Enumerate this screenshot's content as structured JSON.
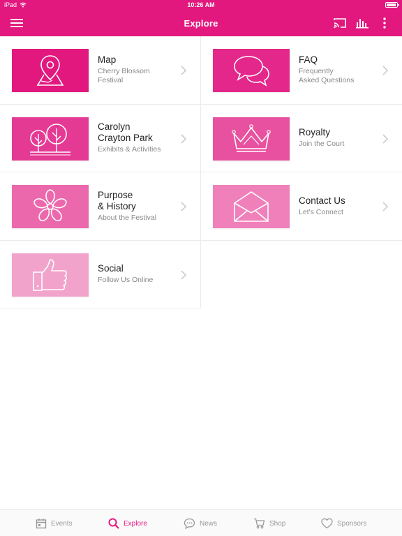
{
  "status_bar": {
    "carrier": "iPad",
    "time": "10:26 AM"
  },
  "nav": {
    "title": "Explore",
    "bar_color": "#e2187f",
    "icons": [
      "hamburger-menu-icon",
      "cast-icon",
      "equalizer-icon",
      "more-vertical-icon"
    ]
  },
  "tiles": [
    {
      "title": "Map",
      "subtitle": "Cherry Blossom\nFestival",
      "icon": "map-pin-icon",
      "color": "#e2187f"
    },
    {
      "title": "FAQ",
      "subtitle": "Frequently\nAsked Questions",
      "icon": "chat-bubbles-icon",
      "color": "#e4278a"
    },
    {
      "title": "Carolyn\nCrayton Park",
      "subtitle": "Exhibits & Activities",
      "icon": "trees-icon",
      "color": "#e53a94"
    },
    {
      "title": "Royalty",
      "subtitle": "Join the Court",
      "icon": "crown-icon",
      "color": "#e8519f"
    },
    {
      "title": "Purpose\n& History",
      "subtitle": "About the Festival",
      "icon": "blossom-icon",
      "color": "#ec68ad"
    },
    {
      "title": "Contact Us",
      "subtitle": "Let's Connect",
      "icon": "envelope-icon",
      "color": "#ef80ba"
    },
    {
      "title": "Social",
      "subtitle": "Follow Us Online",
      "icon": "thumbs-up-icon",
      "color": "#f2a3cc"
    }
  ],
  "tabs": [
    {
      "label": "Events",
      "icon": "calendar-icon",
      "active": false
    },
    {
      "label": "Explore",
      "icon": "search-icon",
      "active": true
    },
    {
      "label": "News",
      "icon": "comment-icon",
      "active": false
    },
    {
      "label": "Shop",
      "icon": "cart-icon",
      "active": false
    },
    {
      "label": "Sponsors",
      "icon": "heart-icon",
      "active": false
    }
  ],
  "accent_color": "#e2187f"
}
